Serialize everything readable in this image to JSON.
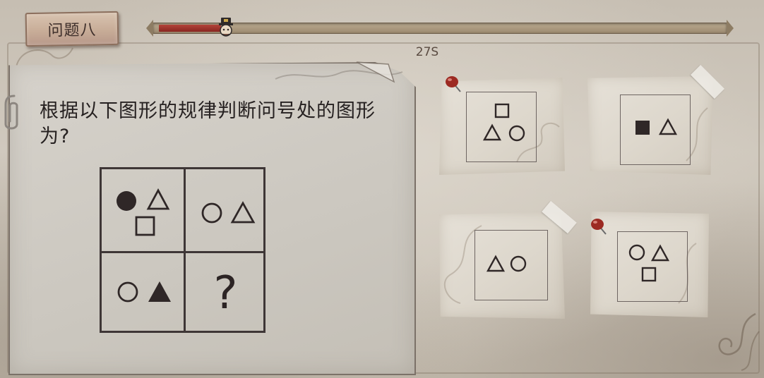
{
  "header": {
    "title": "问题八",
    "timer_text": "27S",
    "progress_fraction": 0.11
  },
  "question": {
    "text": "根据以下图形的规律判断问号处的图形为?",
    "grid": [
      {
        "cell": "top-left",
        "shapes": [
          "filled-circle",
          "outline-triangle",
          "outline-square"
        ]
      },
      {
        "cell": "top-right",
        "shapes": [
          "outline-circle",
          "outline-triangle"
        ]
      },
      {
        "cell": "bottom-left",
        "shapes": [
          "outline-circle",
          "filled-triangle"
        ]
      },
      {
        "cell": "bottom-right",
        "text": "?"
      }
    ]
  },
  "answers": [
    {
      "id": "a",
      "shapes": [
        "outline-square",
        "outline-triangle",
        "outline-circle"
      ],
      "attachment": "red-pin"
    },
    {
      "id": "b",
      "shapes": [
        "filled-square",
        "outline-triangle"
      ],
      "attachment": "tape"
    },
    {
      "id": "c",
      "shapes": [
        "outline-triangle",
        "outline-circle"
      ],
      "attachment": "tape"
    },
    {
      "id": "d",
      "shapes": [
        "outline-circle",
        "outline-triangle",
        "outline-square"
      ],
      "attachment": "red-pin"
    }
  ],
  "colors": {
    "ink": "#2f2727",
    "progress_fill": "#a3362f",
    "pin_red": "#9c2a22"
  }
}
